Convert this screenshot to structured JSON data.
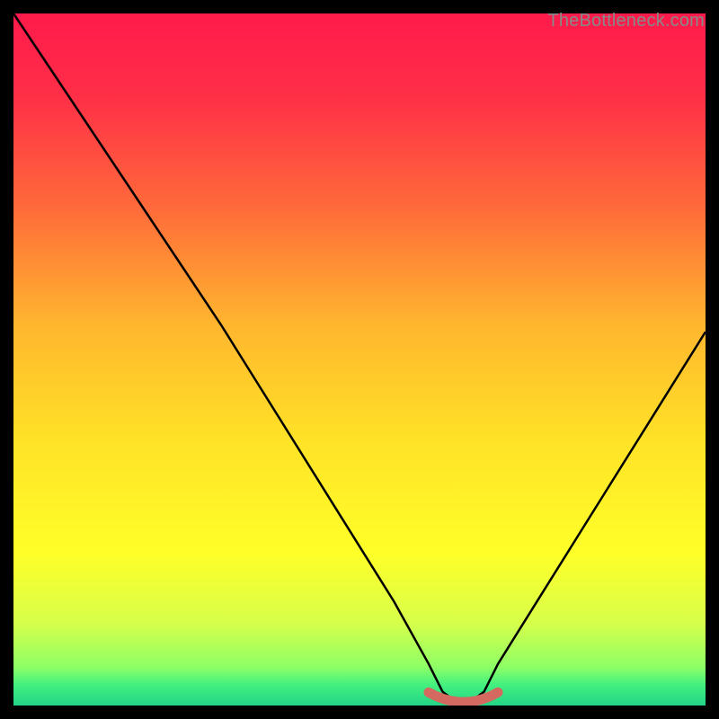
{
  "watermark": {
    "text": "TheBottleneck.com"
  },
  "colors": {
    "background": "#000000",
    "curve": "#000000",
    "marker": "#d46a5f",
    "gradient_stops": [
      {
        "offset": 0.0,
        "color": "#ff1a4b"
      },
      {
        "offset": 0.12,
        "color": "#ff2f47"
      },
      {
        "offset": 0.28,
        "color": "#ff6a3a"
      },
      {
        "offset": 0.45,
        "color": "#ffb62e"
      },
      {
        "offset": 0.62,
        "color": "#ffe327"
      },
      {
        "offset": 0.78,
        "color": "#ffff28"
      },
      {
        "offset": 0.88,
        "color": "#d7ff4a"
      },
      {
        "offset": 0.945,
        "color": "#8dff66"
      },
      {
        "offset": 0.97,
        "color": "#43f07f"
      },
      {
        "offset": 1.0,
        "color": "#23d486"
      }
    ]
  },
  "chart_data": {
    "type": "line",
    "title": "",
    "xlabel": "",
    "ylabel": "",
    "xlim": [
      0,
      100
    ],
    "ylim": [
      0,
      100
    ],
    "grid": false,
    "legend": false,
    "series": [
      {
        "name": "bottleneck-curve",
        "x": [
          0,
          5,
          10,
          15,
          20,
          25,
          30,
          35,
          40,
          45,
          50,
          55,
          60,
          62,
          64,
          66,
          68,
          70,
          75,
          80,
          85,
          90,
          95,
          100
        ],
        "y": [
          100,
          92.5,
          85,
          77.5,
          70,
          62.5,
          55,
          47,
          39,
          31,
          23,
          15,
          6,
          2,
          0.5,
          0.5,
          2,
          6,
          14,
          22,
          30,
          38,
          46,
          54
        ]
      }
    ],
    "annotations": [
      {
        "name": "min-marker",
        "x_range": [
          60,
          70
        ],
        "y": 0.5
      }
    ]
  }
}
